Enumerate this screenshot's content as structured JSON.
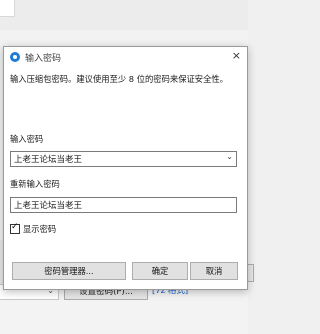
{
  "background": {
    "settings_button_label": "设置密码(P)...",
    "format_link": "[7z 格式]"
  },
  "dialog": {
    "title": "输入密码",
    "close_symbol": "×",
    "intro_text": "输入压缩包密码。建议使用至少 8 位的密码来保证安全性。",
    "password_label": "输入密码",
    "password_value": "上老王论坛当老王",
    "reenter_label": "重新输入密码",
    "reenter_value": "上老王论坛当老王",
    "show_password_label": "显示密码",
    "show_password_checked": true,
    "buttons": {
      "manager": "密码管理器...",
      "ok": "确定",
      "cancel": "取消"
    }
  },
  "icons": {
    "title": "app-logo-icon",
    "dropdown": "chevron-down-icon",
    "check": "checkmark-icon"
  },
  "colors": {
    "accent": "#1e7bd6",
    "link": "#0b5fcc"
  }
}
